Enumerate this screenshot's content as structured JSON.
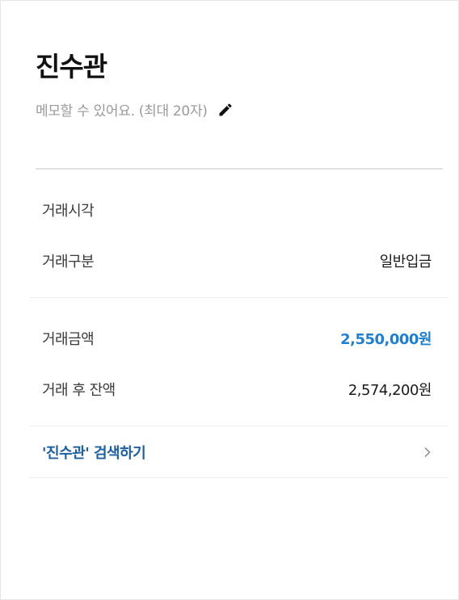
{
  "header": {
    "title": "진수관",
    "memo_placeholder": "메모할 수 있어요. (최대 20자)",
    "edit_icon": "pencil-icon"
  },
  "details": {
    "time_label": "거래시각",
    "time_value": "",
    "type_label": "거래구분",
    "type_value": "일반입금"
  },
  "amounts": {
    "amount_label": "거래금액",
    "amount_value": "2,550,000원",
    "balance_label": "거래 후 잔액",
    "balance_value": "2,574,200원",
    "accent_color": "#1f7fd1"
  },
  "search": {
    "label": "'진수관' 검색하기",
    "icon": "chevron-right-icon"
  }
}
